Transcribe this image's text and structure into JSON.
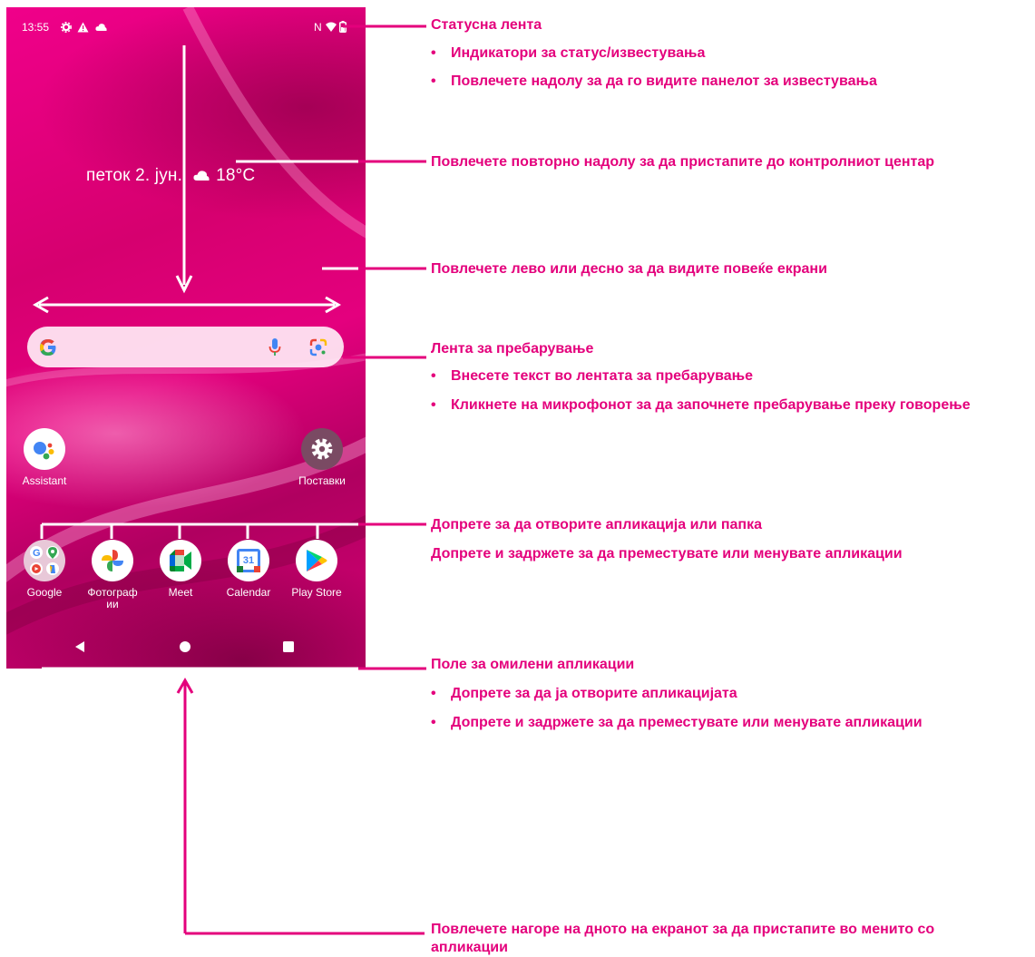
{
  "status_bar": {
    "time": "13:55"
  },
  "home": {
    "date_weather": "петок 2. јун.",
    "temperature": "18°C",
    "top_apps": [
      {
        "label": "Assistant"
      },
      {
        "label": "Поставки"
      }
    ],
    "apps_row": [
      {
        "label": "Google",
        "icon": "google-folder-icon"
      },
      {
        "label": "Фотограф ии",
        "icon": "photos-icon"
      },
      {
        "label": "Meet",
        "icon": "meet-icon"
      },
      {
        "label": "Calendar",
        "icon": "calendar-icon"
      },
      {
        "label": "Play Store",
        "icon": "play-store-icon"
      }
    ],
    "calendar_day": "31",
    "dock": [
      {
        "icon": "gmail-icon"
      },
      {
        "icon": "phone-icon"
      },
      {
        "icon": "messages-icon"
      },
      {
        "icon": "chrome-icon"
      },
      {
        "icon": "camera-icon"
      }
    ]
  },
  "annotations": {
    "status_bar_title": "Статусна лента",
    "status_bar_bullets": [
      "Индикатори за статус/известувања",
      "Повлечете надолу за да го видите панелот за известувања"
    ],
    "control_center": "Повлечете повторно надолу за да пристапите до контролниот центар",
    "swipe_screens": "Повлечете лево или десно за да видите повеќе екрани",
    "search_title": "Лента за пребарување",
    "search_bullets": [
      "Внесете текст во лентата за пребарување",
      "Кликнете на микрофонот за да започнете пребарување преку говорење"
    ],
    "apps_line1": "Допрете за да отворите апликација или папка",
    "apps_line2": "Допрете и задржете за да преместувате или менувате апликации",
    "favorites_title": "Поле за омилени апликации",
    "favorites_bullets": [
      "Допрете за да ја отворите апликацијата",
      "Допрете и задржете за да преместувате или менувате апликации"
    ],
    "app_drawer": "Повлечете нагоре на дното на екранот за да пристапите во менито со апликации"
  },
  "colors": {
    "accent": "#e4007c",
    "wallpaper": "#e0007a"
  }
}
